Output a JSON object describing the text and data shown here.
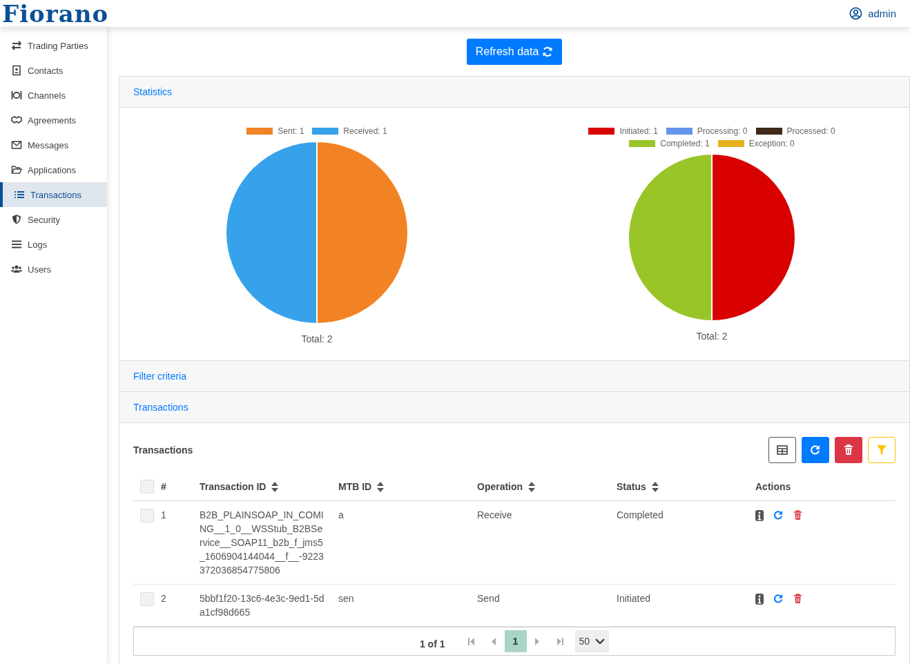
{
  "header": {
    "logo": "Fiorano",
    "user": "admin"
  },
  "sidebar": {
    "items": [
      {
        "label": "Trading Parties",
        "selected": false
      },
      {
        "label": "Contacts",
        "selected": false
      },
      {
        "label": "Channels",
        "selected": false
      },
      {
        "label": "Agreements",
        "selected": false
      },
      {
        "label": "Messages",
        "selected": false
      },
      {
        "label": "Applications",
        "selected": false
      },
      {
        "label": "Transactions",
        "selected": true
      },
      {
        "label": "Security",
        "selected": false
      },
      {
        "label": "Logs",
        "selected": false
      },
      {
        "label": "Users",
        "selected": false
      }
    ]
  },
  "refresh_button": "Refresh data",
  "statistics": {
    "title": "Statistics",
    "charts": [
      {
        "legend": [
          {
            "label": "Sent: 1",
            "color": "#f28324"
          },
          {
            "label": "Received: 1",
            "color": "#36a2eb"
          }
        ],
        "total": "Total: 2",
        "chart_data": {
          "type": "pie",
          "values": [
            50,
            50
          ]
        }
      },
      {
        "legend": [
          {
            "label": "Initiated: 1",
            "color": "#d90000"
          },
          {
            "label": "Processing: 0",
            "color": "#6495ed"
          },
          {
            "label": "Processed: 0",
            "color": "#402918"
          },
          {
            "label": "Completed: 1",
            "color": "#9ac529"
          },
          {
            "label": "Exception: 0",
            "color": "#e6b021"
          }
        ],
        "total": "Total: 2",
        "chart_data": {
          "type": "pie",
          "values": [
            50,
            0,
            0,
            50,
            0
          ]
        }
      }
    ]
  },
  "filter_section": "Filter criteria",
  "transactions_section": "Transactions",
  "table": {
    "title": "Transactions",
    "select_all": {
      "checked": false
    },
    "columns": [
      {
        "label": "#",
        "sortable": false
      },
      {
        "label": "Transaction ID",
        "sortable": true
      },
      {
        "label": "MTB ID",
        "sortable": true
      },
      {
        "label": "Operation",
        "sortable": true
      },
      {
        "label": "Status",
        "sortable": true
      },
      {
        "label": "Actions",
        "sortable": false
      }
    ],
    "rows": [
      {
        "checked": false,
        "cells": [
          "1",
          "B2B_PLAINSOAP_IN_COMING__1_0__WSStub_B2BService__SOAP11_b2b_f_jms5_1606904144044__f__-9223372036854775806",
          "a",
          "Receive",
          "Completed"
        ]
      },
      {
        "checked": false,
        "cells": [
          "2",
          "5bbf1f20-13c6-4e3c-9ed1-5da1cf98d665",
          "sen",
          "Send",
          "Initiated"
        ]
      }
    ]
  },
  "pagination": {
    "summary": "1 of 1",
    "pages": [
      {
        "label": "1",
        "selected": true
      }
    ],
    "page_size": "50"
  }
}
